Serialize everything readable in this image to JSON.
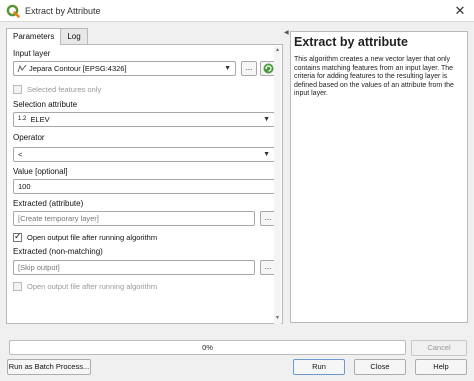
{
  "window": {
    "title": "Extract by Attribute"
  },
  "tabs": [
    {
      "label": "Parameters"
    },
    {
      "label": "Log"
    }
  ],
  "params": {
    "input_layer_label": "Input layer",
    "input_layer_value": "Jepara Contour [EPSG:4326]",
    "input_layer_btn": "...",
    "selected_only_label": "Selected features only",
    "selection_attr_label": "Selection attribute",
    "selection_attr_type": "1.2",
    "selection_attr_value": "ELEV",
    "operator_label": "Operator",
    "operator_value": "<",
    "value_label": "Value [optional]",
    "value_value": "100",
    "extracted_label": "Extracted (attribute)",
    "extracted_placeholder": "[Create temporary layer]",
    "extracted_btn": "...",
    "open_output_label": "Open output file after running algorithm",
    "nonmatch_label": "Extracted (non-matching)",
    "nonmatch_placeholder": "[Skip output]",
    "nonmatch_btn": "...",
    "open_output2_label": "Open output file after running algorithm"
  },
  "help": {
    "title": "Extract by attribute",
    "text": "This algorithm creates a new vector layer that only contains matching features from an input layer. The criteria for adding features to the resulting layer is defined based on the values of an attribute from the input layer."
  },
  "progress": {
    "text": "0%"
  },
  "buttons": {
    "cancel": "Cancel",
    "batch": "Run as Batch Process...",
    "run": "Run",
    "close": "Close",
    "help": "Help"
  },
  "colors": {
    "qgis_green": "#589632",
    "qgis_yellow": "#ee7913",
    "accent_blue": "#6a9ad1"
  }
}
